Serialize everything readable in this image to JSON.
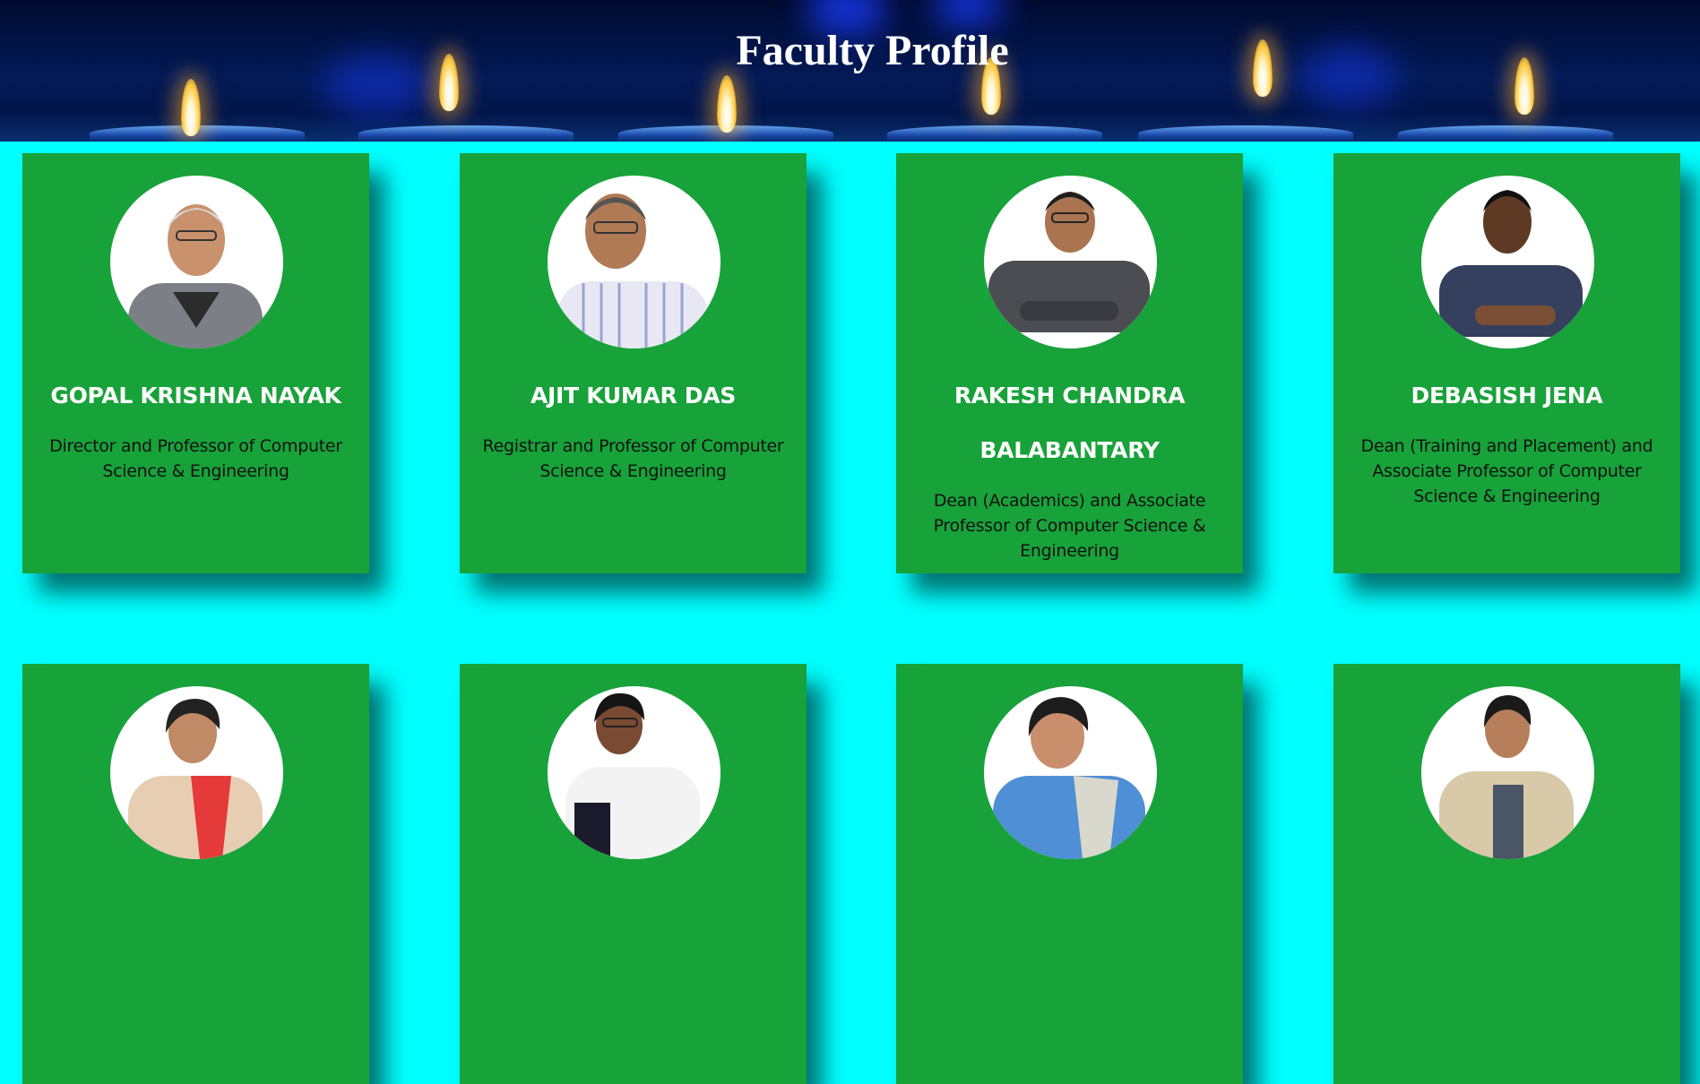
{
  "header": {
    "title": "Faculty Profile"
  },
  "colors": {
    "page_background": "#00ffff",
    "card_background": "#18a23a",
    "banner_background": "#031a57"
  },
  "faculty": [
    {
      "name": "GOPAL KRISHNA NAYAK",
      "role": "Director and Professor of Computer Science & Engineering",
      "photo": "male-portrait-grey-jacket"
    },
    {
      "name": "AJIT KUMAR DAS",
      "role": "Registrar and Professor of Computer Science & Engineering",
      "photo": "male-portrait-striped-shirt"
    },
    {
      "name": "RAKESH CHANDRA BALABANTARY",
      "role": "Dean (Academics) and Associate Professor of Computer Science & Engineering",
      "photo": "male-portrait-dark-shirt"
    },
    {
      "name": "DEBASISH JENA",
      "role": "Dean (Training and Placement) and Associate Professor of Computer Science & Engineering",
      "photo": "male-portrait-polo-shirt"
    },
    {
      "name": "",
      "role": "",
      "photo": "female-portrait-beige-red-scarf"
    },
    {
      "name": "",
      "role": "",
      "photo": "female-portrait-white-shawl"
    },
    {
      "name": "",
      "role": "",
      "photo": "female-portrait-blue-saree"
    },
    {
      "name": "",
      "role": "",
      "photo": "female-portrait-cream-shawl"
    }
  ]
}
